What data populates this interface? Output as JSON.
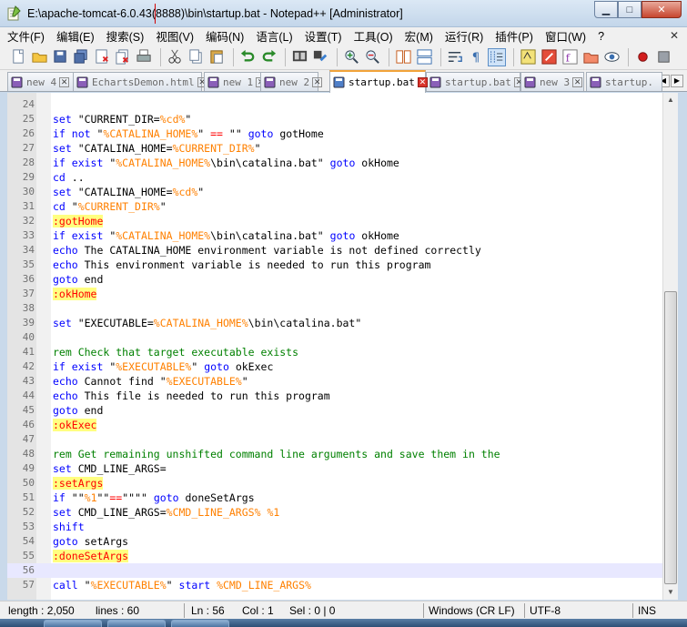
{
  "window": {
    "title": "E:\\apache-tomcat-6.0.43(8888)\\bin\\startup.bat - Notepad++ [Administrator]"
  },
  "window_controls": {
    "minimize": "▁",
    "maximize": "□",
    "close": "✕"
  },
  "menu": {
    "items": [
      "文件(F)",
      "编辑(E)",
      "搜索(S)",
      "视图(V)",
      "编码(N)",
      "语言(L)",
      "设置(T)",
      "工具(O)",
      "宏(M)",
      "运行(R)",
      "插件(P)",
      "窗口(W)",
      "?"
    ],
    "close_doc": "✕"
  },
  "toolbar": {
    "buttons": [
      {
        "name": "new-file-icon"
      },
      {
        "name": "open-file-icon"
      },
      {
        "name": "save-icon"
      },
      {
        "name": "save-all-icon"
      },
      {
        "name": "close-icon"
      },
      {
        "name": "close-all-icon"
      },
      {
        "name": "print-icon"
      },
      {
        "name": "cut-icon"
      },
      {
        "name": "copy-icon"
      },
      {
        "name": "paste-icon"
      },
      {
        "name": "undo-icon"
      },
      {
        "name": "redo-icon"
      },
      {
        "name": "find-icon"
      },
      {
        "name": "replace-icon"
      },
      {
        "name": "zoom-in-icon"
      },
      {
        "name": "zoom-out-icon"
      },
      {
        "name": "sync-vertical-icon"
      },
      {
        "name": "sync-horizontal-icon"
      },
      {
        "name": "word-wrap-icon"
      },
      {
        "name": "show-all-chars-icon"
      },
      {
        "name": "indent-guide-icon"
      },
      {
        "name": "user-language-icon"
      },
      {
        "name": "doc-map-icon"
      },
      {
        "name": "function-list-icon"
      },
      {
        "name": "folder-workspace-icon"
      },
      {
        "name": "monitor-icon"
      },
      {
        "name": "record-macro-icon"
      },
      {
        "name": "stop-record-icon"
      }
    ]
  },
  "tabs": [
    {
      "label": "new 4",
      "active": false
    },
    {
      "label": "EchartsDemon.html",
      "active": false
    },
    {
      "label": "new 1",
      "active": false
    },
    {
      "label": "new 2",
      "active": false
    },
    {
      "label": "startup.bat",
      "active": true
    },
    {
      "label": "startup.bat",
      "active": false
    },
    {
      "label": "new 3",
      "active": false
    },
    {
      "label": "startup.",
      "active": false
    }
  ],
  "tab_scroll": {
    "left": "◀",
    "right": "▶"
  },
  "editor": {
    "current_line": 56,
    "lines": [
      {
        "n": "24",
        "tokens": []
      },
      {
        "n": "25",
        "tokens": [
          [
            "kw",
            "set"
          ],
          [
            "txt",
            " \"CURRENT_DIR="
          ],
          [
            "var",
            "%cd%"
          ],
          [
            "txt",
            "\""
          ]
        ]
      },
      {
        "n": "26",
        "tokens": [
          [
            "kw",
            "if not"
          ],
          [
            "txt",
            " \""
          ],
          [
            "var",
            "%CATALINA_HOME%"
          ],
          [
            "txt",
            "\" "
          ],
          [
            "op",
            "=="
          ],
          [
            "txt",
            " \"\" "
          ],
          [
            "kw",
            "goto"
          ],
          [
            "txt",
            " gotHome"
          ]
        ]
      },
      {
        "n": "27",
        "tokens": [
          [
            "kw",
            "set"
          ],
          [
            "txt",
            " \"CATALINA_HOME="
          ],
          [
            "var",
            "%CURRENT_DIR%"
          ],
          [
            "txt",
            "\""
          ]
        ]
      },
      {
        "n": "28",
        "tokens": [
          [
            "kw",
            "if exist"
          ],
          [
            "txt",
            " \""
          ],
          [
            "var",
            "%CATALINA_HOME%"
          ],
          [
            "txt",
            "\\bin\\catalina.bat\" "
          ],
          [
            "kw",
            "goto"
          ],
          [
            "txt",
            " okHome"
          ]
        ]
      },
      {
        "n": "29",
        "tokens": [
          [
            "kw",
            "cd"
          ],
          [
            "txt",
            " .."
          ]
        ]
      },
      {
        "n": "30",
        "tokens": [
          [
            "kw",
            "set"
          ],
          [
            "txt",
            " \"CATALINA_HOME="
          ],
          [
            "var",
            "%cd%"
          ],
          [
            "txt",
            "\""
          ]
        ]
      },
      {
        "n": "31",
        "tokens": [
          [
            "kw",
            "cd"
          ],
          [
            "txt",
            " \""
          ],
          [
            "var",
            "%CURRENT_DIR%"
          ],
          [
            "txt",
            "\""
          ]
        ]
      },
      {
        "n": "32",
        "tokens": [
          [
            "lbl",
            ":gotHome"
          ]
        ]
      },
      {
        "n": "33",
        "tokens": [
          [
            "kw",
            "if exist"
          ],
          [
            "txt",
            " \""
          ],
          [
            "var",
            "%CATALINA_HOME%"
          ],
          [
            "txt",
            "\\bin\\catalina.bat\" "
          ],
          [
            "kw",
            "goto"
          ],
          [
            "txt",
            " okHome"
          ]
        ]
      },
      {
        "n": "34",
        "tokens": [
          [
            "kw",
            "echo"
          ],
          [
            "txt",
            " The CATALINA_HOME environment variable is not defined correctly"
          ]
        ]
      },
      {
        "n": "35",
        "tokens": [
          [
            "kw",
            "echo"
          ],
          [
            "txt",
            " This environment variable is needed to run this program"
          ]
        ]
      },
      {
        "n": "36",
        "tokens": [
          [
            "kw",
            "goto"
          ],
          [
            "txt",
            " end"
          ]
        ]
      },
      {
        "n": "37",
        "tokens": [
          [
            "lbl",
            ":okHome"
          ]
        ]
      },
      {
        "n": "38",
        "tokens": []
      },
      {
        "n": "39",
        "tokens": [
          [
            "kw",
            "set"
          ],
          [
            "txt",
            " \"EXECUTABLE="
          ],
          [
            "var",
            "%CATALINA_HOME%"
          ],
          [
            "txt",
            "\\bin\\catalina.bat\""
          ]
        ]
      },
      {
        "n": "40",
        "tokens": []
      },
      {
        "n": "41",
        "tokens": [
          [
            "cmt",
            "rem Check that target executable exists"
          ]
        ]
      },
      {
        "n": "42",
        "tokens": [
          [
            "kw",
            "if exist"
          ],
          [
            "txt",
            " \""
          ],
          [
            "var",
            "%EXECUTABLE%"
          ],
          [
            "txt",
            "\" "
          ],
          [
            "kw",
            "goto"
          ],
          [
            "txt",
            " okExec"
          ]
        ]
      },
      {
        "n": "43",
        "tokens": [
          [
            "kw",
            "echo"
          ],
          [
            "txt",
            " Cannot find \""
          ],
          [
            "var",
            "%EXECUTABLE%"
          ],
          [
            "txt",
            "\""
          ]
        ]
      },
      {
        "n": "44",
        "tokens": [
          [
            "kw",
            "echo"
          ],
          [
            "txt",
            " This file is needed to run this program"
          ]
        ]
      },
      {
        "n": "45",
        "tokens": [
          [
            "kw",
            "goto"
          ],
          [
            "txt",
            " end"
          ]
        ]
      },
      {
        "n": "46",
        "tokens": [
          [
            "lbl",
            ":okExec"
          ]
        ]
      },
      {
        "n": "47",
        "tokens": []
      },
      {
        "n": "48",
        "tokens": [
          [
            "cmt",
            "rem Get remaining unshifted command line arguments and save them in the"
          ]
        ]
      },
      {
        "n": "49",
        "tokens": [
          [
            "kw",
            "set"
          ],
          [
            "txt",
            " CMD_LINE_ARGS="
          ]
        ]
      },
      {
        "n": "50",
        "tokens": [
          [
            "lbl",
            ":setArgs"
          ]
        ]
      },
      {
        "n": "51",
        "tokens": [
          [
            "kw",
            "if"
          ],
          [
            "txt",
            " \"\""
          ],
          [
            "var",
            "%1"
          ],
          [
            "txt",
            "\"\""
          ],
          [
            "op",
            "=="
          ],
          [
            "txt",
            "\"\"\"\" "
          ],
          [
            "kw",
            "goto"
          ],
          [
            "txt",
            " doneSetArgs"
          ]
        ]
      },
      {
        "n": "52",
        "tokens": [
          [
            "kw",
            "set"
          ],
          [
            "txt",
            " CMD_LINE_ARGS="
          ],
          [
            "var",
            "%CMD_LINE_ARGS%"
          ],
          [
            "txt",
            " "
          ],
          [
            "var",
            "%1"
          ]
        ]
      },
      {
        "n": "53",
        "tokens": [
          [
            "kw",
            "shift"
          ]
        ]
      },
      {
        "n": "54",
        "tokens": [
          [
            "kw",
            "goto"
          ],
          [
            "txt",
            " setArgs"
          ]
        ]
      },
      {
        "n": "55",
        "tokens": [
          [
            "lbl",
            ":doneSetArgs"
          ]
        ]
      },
      {
        "n": "56",
        "tokens": []
      },
      {
        "n": "57",
        "tokens": [
          [
            "kw",
            "call"
          ],
          [
            "txt",
            " \""
          ],
          [
            "var",
            "%EXECUTABLE%"
          ],
          [
            "txt",
            "\" "
          ],
          [
            "kw",
            "start"
          ],
          [
            "txt",
            " "
          ],
          [
            "var",
            "%CMD_LINE_ARGS%"
          ]
        ]
      }
    ]
  },
  "status": {
    "length": "length : 2,050",
    "lines": "lines : 60",
    "ln": "Ln : 56",
    "col": "Col : 1",
    "sel": "Sel : 0 | 0",
    "eol": "Windows (CR LF)",
    "encoding": "UTF-8",
    "mode": "INS"
  },
  "colors": {
    "keyword": "#0000ff",
    "variable": "#ff8000",
    "operator": "#ff0000",
    "comment": "#008000",
    "label_bg": "#ffff80",
    "active_tab_accent": "#f2a33a"
  }
}
